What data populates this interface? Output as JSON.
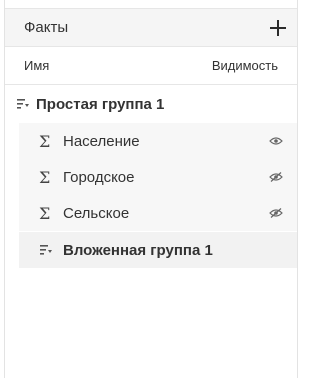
{
  "header": {
    "title": "Факты",
    "add_icon": "plus-icon"
  },
  "columns": {
    "name": "Имя",
    "visibility": "Видимость"
  },
  "group": {
    "label": "Простая группа 1",
    "icon": "group-sort-icon"
  },
  "facts": [
    {
      "label": "Население",
      "visibility": "visible"
    },
    {
      "label": "Городское",
      "visibility": "hidden"
    },
    {
      "label": "Сельское",
      "visibility": "hidden"
    }
  ],
  "nested_group": {
    "label": "Вложенная группа 1",
    "icon": "group-sort-icon"
  },
  "sigma_symbol": "Σ"
}
